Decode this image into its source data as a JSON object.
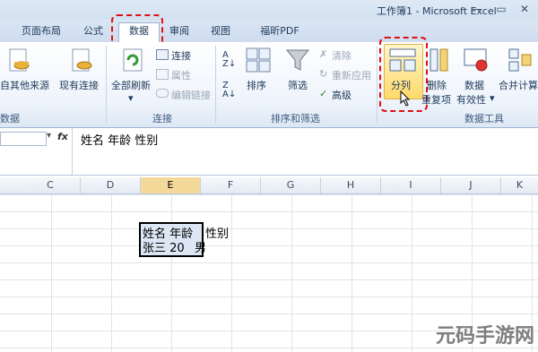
{
  "window": {
    "title": "工作簿1 - Microsoft Excel"
  },
  "tabs": [
    {
      "label": "页面布局"
    },
    {
      "label": "公式"
    },
    {
      "label": "数据"
    },
    {
      "label": "审阅"
    },
    {
      "label": "视图"
    },
    {
      "label": "福昕PDF"
    }
  ],
  "ribbon": {
    "get_external": {
      "label": "自其他来源",
      "group": "数据"
    },
    "existing_connections": {
      "label": "现有连接"
    },
    "refresh_all": {
      "label": "全部刷新"
    },
    "connections": {
      "label": "连接"
    },
    "properties": {
      "label": "属性"
    },
    "edit_links": {
      "label": "编辑链接"
    },
    "connections_group": "连接",
    "sort_asc": "A↓Z",
    "sort": {
      "label": "排序"
    },
    "filter": {
      "label": "筛选"
    },
    "clear": {
      "label": "清除"
    },
    "reapply": {
      "label": "重新应用"
    },
    "advanced": {
      "label": "高级"
    },
    "sort_filter_group": "排序和筛选",
    "text_to_columns": {
      "label": "分列"
    },
    "remove_duplicates": {
      "label_line1": "删除",
      "label_line2": "重复项"
    },
    "data_validation": {
      "label_line1": "数据",
      "label_line2": "有效性"
    },
    "consolidate": {
      "label": "合并计算"
    },
    "data_tools_group": "数据工具"
  },
  "formula_bar": {
    "fx": "fx",
    "content": "姓名 年龄 性别"
  },
  "columns": [
    "C",
    "D",
    "E",
    "F",
    "G",
    "H",
    "I",
    "J",
    "K"
  ],
  "selected_column": "E",
  "cells": {
    "e1": "姓名 年龄",
    "e1_tail": "性别",
    "e2": "张三  20",
    "e2_tail": "男"
  },
  "watermark": "元码手游网",
  "colors": {
    "accent_red": "#d11111",
    "selection": "#f5d99a"
  }
}
